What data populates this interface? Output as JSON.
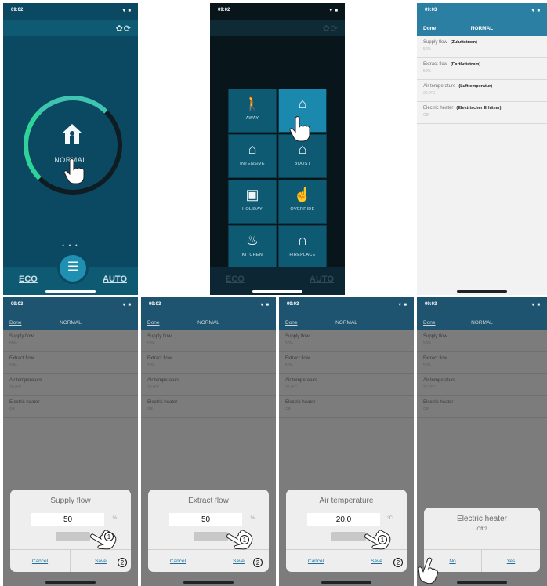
{
  "status": {
    "time_a": "09:02",
    "time_b": "09:03",
    "time_c": "09:03",
    "signal": "▾ ■"
  },
  "main_screen": {
    "mode": "NORMAL",
    "eco": "ECO",
    "auto": "AUTO",
    "dots": "• • •"
  },
  "menu_screen": {
    "tiles": [
      {
        "label": "AWAY",
        "icon": "away-icon"
      },
      {
        "label": "",
        "icon": "home-icon"
      },
      {
        "label": "INTENSIVE",
        "icon": "intensive-icon"
      },
      {
        "label": "BOOST",
        "icon": "boost-icon"
      },
      {
        "label": "HOLIDAY",
        "icon": "holiday-icon"
      },
      {
        "label": "OVERRIDE",
        "icon": "override-icon"
      },
      {
        "label": "KITCHEN",
        "icon": "kitchen-icon"
      },
      {
        "label": "FIREPLACE",
        "icon": "fireplace-icon"
      }
    ],
    "eco": "ECO",
    "auto": "AUTO"
  },
  "settings_screen": {
    "done": "Done",
    "title": "NORMAL",
    "rows": [
      {
        "name": "Supply flow",
        "translation": "(Zuluftstrom)",
        "value": "50%"
      },
      {
        "name": "Extract flow",
        "translation": "(Fortluftstrom)",
        "value": "50%"
      },
      {
        "name": "Air temperature",
        "translation": "(Lufttemperatur)",
        "value": "20.0°C"
      },
      {
        "name": "Electric heater",
        "translation": "(Elektrischer Erhitzer)",
        "value": "Off"
      }
    ]
  },
  "dialog_screens": {
    "done": "Done",
    "title": "NORMAL",
    "rows": [
      {
        "name": "Supply flow",
        "value": "50%"
      },
      {
        "name": "Extract flow",
        "value": "50%"
      },
      {
        "name": "Air temperature",
        "value": "20.0°C"
      },
      {
        "name": "Electric heater",
        "value": "Off"
      }
    ],
    "supply": {
      "title": "Supply flow",
      "value": "50",
      "unit": "%",
      "cancel": "Cancel",
      "save": "Save"
    },
    "extract": {
      "title": "Extract flow",
      "value": "50",
      "unit": "%",
      "cancel": "Cancel",
      "save": "Save"
    },
    "air": {
      "title": "Air temperature",
      "value": "20.0",
      "unit": "°C",
      "cancel": "Cancel",
      "save": "Save"
    },
    "heater": {
      "title": "Electric heater",
      "question": "Off ?",
      "no": "No",
      "yes": "Yes"
    }
  },
  "markers": {
    "one": "1",
    "two": "2"
  }
}
